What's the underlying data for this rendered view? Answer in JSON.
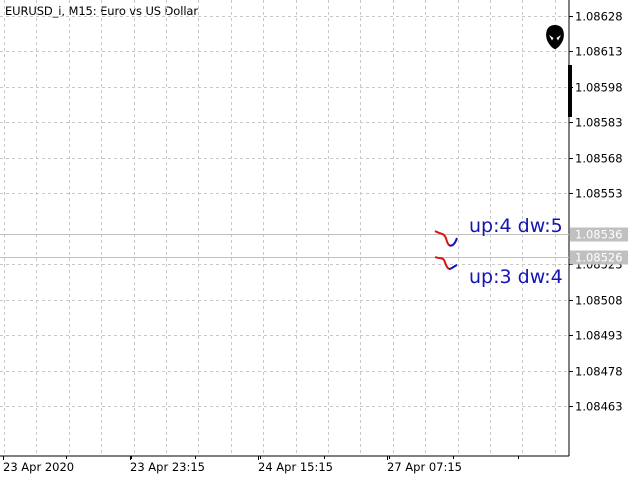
{
  "window": {
    "title": "EURUSD_i, M15:  Euro vs US Dollar"
  },
  "icon": {
    "name": "alien-head-icon"
  },
  "price_axis": {
    "ticks": [
      "1.08628",
      "1.08613",
      "1.08598",
      "1.08583",
      "1.08568",
      "1.08553",
      "1.08523",
      "1.08508",
      "1.08493",
      "1.08478",
      "1.08463"
    ],
    "min": 1.0845,
    "max": 1.08635
  },
  "time_axis": {
    "labels": [
      "23 Apr 2020",
      "23 Apr 23:15",
      "24 Apr 15:15",
      "27 Apr 07:15"
    ]
  },
  "horizontal_lines": [
    {
      "price": 1.08536,
      "label": "1.08536",
      "color": "#c0c0c0"
    },
    {
      "price": 1.08526,
      "label": "1.08526",
      "color": "#c0c0c0"
    }
  ],
  "annotations": [
    {
      "text": "up:4 dw:5",
      "color": "#1414b4"
    },
    {
      "text": "up:3 dw:4",
      "color": "#1414b4"
    }
  ],
  "colors": {
    "grid": "#c8c8c8",
    "axis": "#000000",
    "up_color": "#1414b4",
    "down_color": "#dc1414",
    "price_tag_bg": "#c0c0c0"
  }
}
